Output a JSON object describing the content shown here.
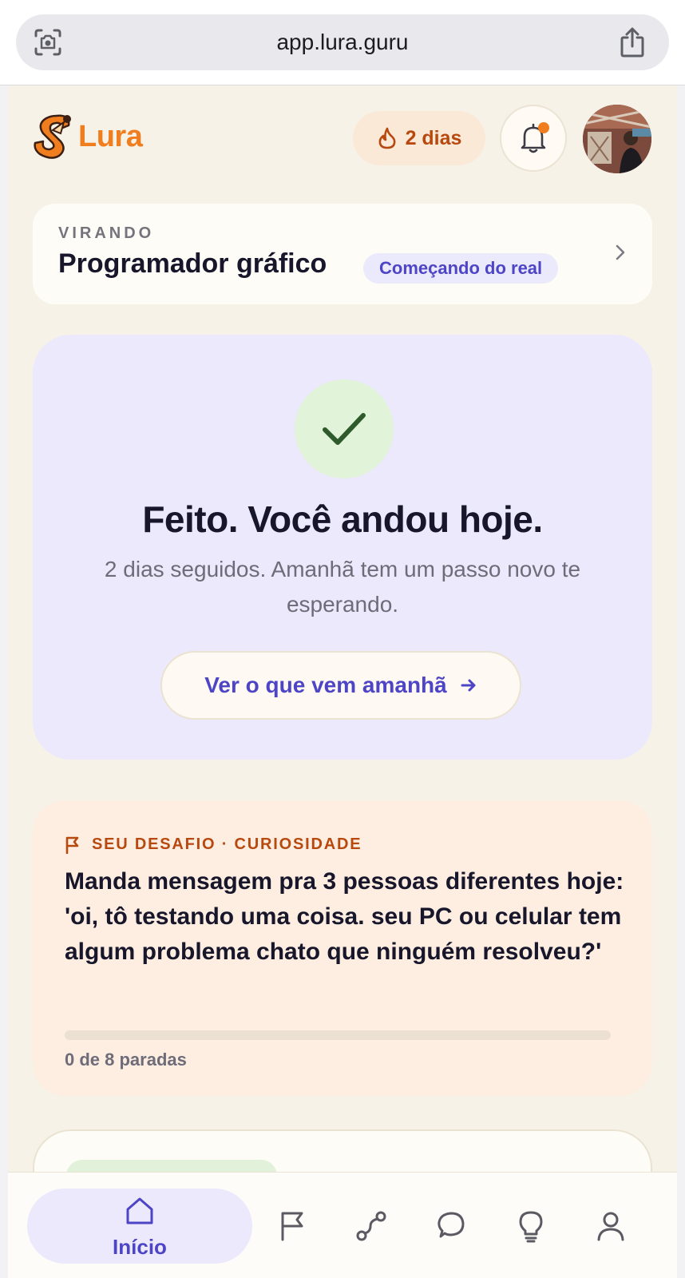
{
  "browser": {
    "url": "app.lura.guru",
    "left_icon": "screen-capture-icon",
    "right_icon": "share-icon"
  },
  "header": {
    "brand": "Lura",
    "streak_label": "2 dias",
    "streak_icon": "flame-icon",
    "notification_icon": "bell-icon",
    "has_notification": true
  },
  "role": {
    "kicker": "VIRANDO",
    "title": "Programador gráfico",
    "badge": "Começando do real"
  },
  "done": {
    "title": "Feito. Você andou hoje.",
    "subtitle": "2 dias seguidos. Amanhã tem um passo novo te esperando.",
    "button_label": "Ver o que vem amanhã"
  },
  "challenge": {
    "kicker": "SEU DESAFIO · CURIOSIDADE",
    "text": "Manda mensagem pra 3 pessoas diferentes hoje: 'oi, tô testando uma coisa. seu PC ou celular tem algum problema chato que ninguém resolveu?'",
    "progress_done": 0,
    "progress_total": 8,
    "progress_label": "0 de 8 paradas"
  },
  "nav": {
    "items": [
      {
        "label": "Início",
        "icon": "home-icon",
        "active": true
      },
      {
        "label": "",
        "icon": "flag-icon",
        "active": false
      },
      {
        "label": "",
        "icon": "route-icon",
        "active": false
      },
      {
        "label": "",
        "icon": "chat-icon",
        "active": false
      },
      {
        "label": "",
        "icon": "lightbulb-icon",
        "active": false
      },
      {
        "label": "",
        "icon": "profile-icon",
        "active": false
      }
    ]
  },
  "colors": {
    "accent": "#f07d1e",
    "primary": "#4d45c6",
    "background": "#f6f2e8",
    "done_card": "#ebe9fb",
    "challenge_card": "#fdeee1",
    "text": "#17162b"
  }
}
